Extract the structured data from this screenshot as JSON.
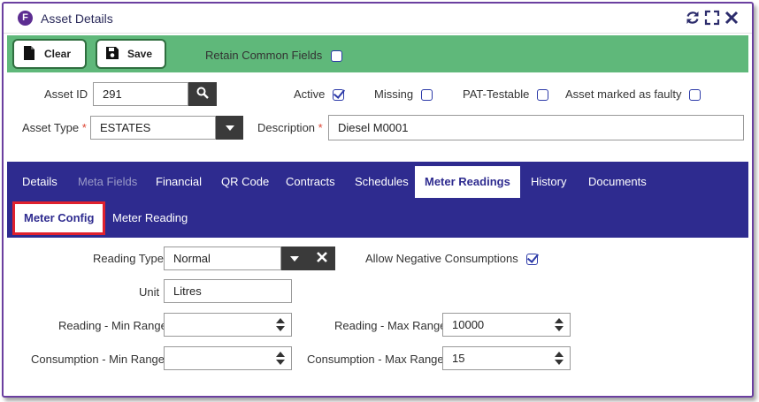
{
  "window": {
    "title": "Asset Details",
    "logo_letter": "F"
  },
  "toolbar": {
    "clear_label": "Clear",
    "save_label": "Save",
    "retain_label": "Retain Common Fields",
    "retain_checked": false
  },
  "form": {
    "asset_id_label": "Asset ID",
    "asset_id_value": "291",
    "active_label": "Active",
    "active_checked": true,
    "missing_label": "Missing",
    "missing_checked": false,
    "pat_label": "PAT-Testable",
    "pat_checked": false,
    "faulty_label": "Asset marked as faulty",
    "faulty_checked": false,
    "asset_type_label": "Asset Type",
    "asset_type_value": "ESTATES",
    "description_label": "Description",
    "description_value": "Diesel M0001",
    "required_marker": "*"
  },
  "tabs": [
    {
      "label": "Details",
      "state": "normal"
    },
    {
      "label": "Meta Fields",
      "state": "disabled"
    },
    {
      "label": "Financial",
      "state": "normal"
    },
    {
      "label": "QR Code",
      "state": "normal"
    },
    {
      "label": "Contracts",
      "state": "normal"
    },
    {
      "label": "Schedules",
      "state": "normal"
    },
    {
      "label": "Meter Readings",
      "state": "active"
    },
    {
      "label": "History",
      "state": "normal"
    },
    {
      "label": "Documents",
      "state": "normal"
    }
  ],
  "subtabs": [
    {
      "label": "Meter Config",
      "state": "active"
    },
    {
      "label": "Meter Reading",
      "state": "normal"
    }
  ],
  "meter": {
    "reading_type_label": "Reading Type",
    "reading_type_value": "Normal",
    "allow_negative_label": "Allow Negative Consumptions",
    "allow_negative_checked": true,
    "unit_label": "Unit",
    "unit_value": "Litres",
    "reading_min_label": "Reading - Min Range",
    "reading_min_value": "",
    "reading_max_label": "Reading - Max Range",
    "reading_max_value": "10000",
    "consumption_min_label": "Consumption - Min Range",
    "consumption_min_value": "",
    "consumption_max_label": "Consumption - Max Range",
    "consumption_max_value": "15"
  },
  "colors": {
    "brand": "#5c2d91",
    "toolbar": "#5fb87a",
    "tabbar": "#2e2b8f",
    "highlight": "#e0212e"
  },
  "icons": [
    "refresh-icon",
    "expand-icon",
    "close-icon",
    "file-icon",
    "floppy-icon",
    "search-icon",
    "chevron-down-icon",
    "clear-x-icon",
    "spinner-icon"
  ]
}
